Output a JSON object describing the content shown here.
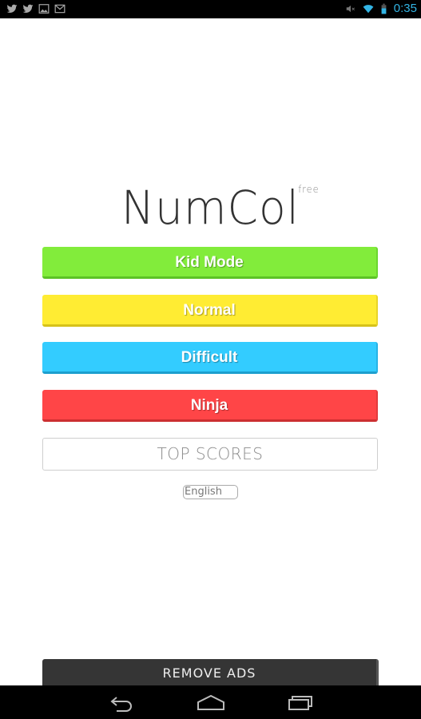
{
  "status_bar": {
    "left_icons": [
      "twitter-icon",
      "twitter-icon",
      "image-icon",
      "gmail-icon"
    ],
    "right_icons": [
      "mute-icon",
      "wifi-icon",
      "battery-icon"
    ],
    "time": "0:35",
    "clock_color": "#33b5e5"
  },
  "logo": {
    "title": "NumCol",
    "badge": "free"
  },
  "modes": [
    {
      "label": "Kid Mode",
      "color": "#82ec3b"
    },
    {
      "label": "Normal",
      "color": "#ffec33"
    },
    {
      "label": "Difficult",
      "color": "#33ccff"
    },
    {
      "label": "Ninja",
      "color": "#ff4547"
    }
  ],
  "top_scores_label": "TOP SCORES",
  "language": {
    "selected": "English"
  },
  "remove_ads_label": "REMOVE ADS",
  "nav_bar": {
    "buttons": [
      "back-icon",
      "home-icon",
      "recent-apps-icon"
    ]
  }
}
